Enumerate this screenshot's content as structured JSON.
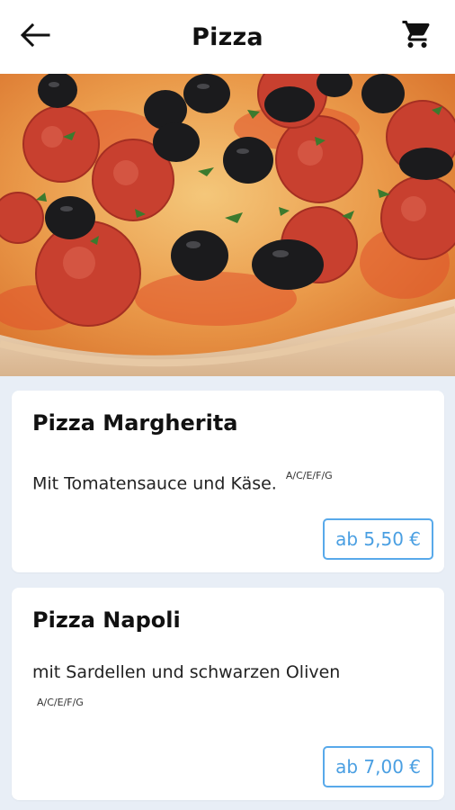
{
  "header": {
    "title": "Pizza",
    "back_icon": "arrow-left-icon",
    "cart_icon": "shopping-cart-icon"
  },
  "hero": {
    "image": "pizza-photo"
  },
  "menu": {
    "items": [
      {
        "name": "Pizza Margherita",
        "description": "Mit Tomatensauce und Käse.",
        "allergens": "A/C/E/F/G",
        "price": "ab 5,50 €"
      },
      {
        "name": "Pizza Napoli",
        "description": "mit Sardellen und schwarzen Oliven",
        "allergens": "A/C/E/F/G",
        "price": "ab 7,00 €"
      }
    ]
  },
  "colors": {
    "accent": "#58a9ea",
    "background": "#e8eef6",
    "card": "#ffffff"
  }
}
